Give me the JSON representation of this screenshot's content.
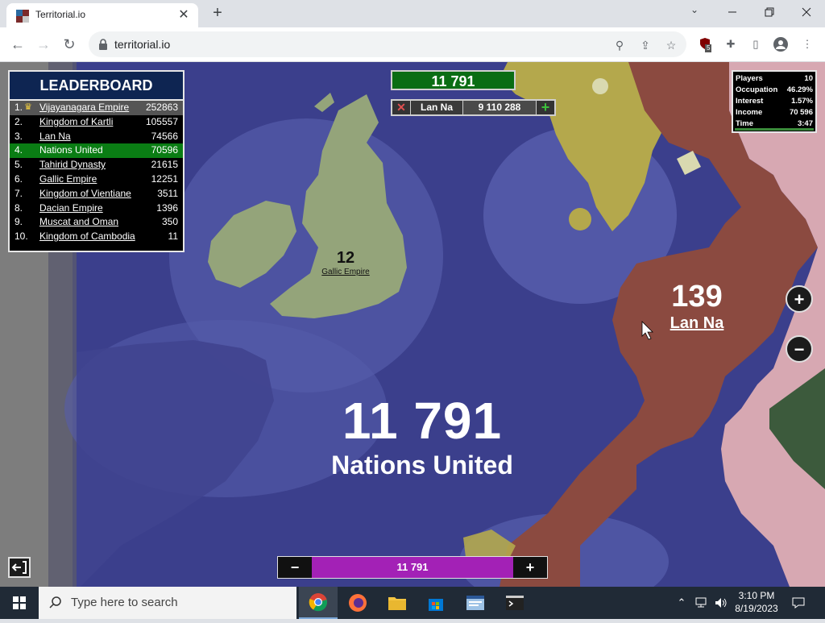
{
  "browser": {
    "tab_title": "Territorial.io",
    "url": "territorial.io",
    "extension_badge": "5"
  },
  "leaderboard": {
    "title": "LEADERBOARD",
    "rows": [
      {
        "rank": "1.",
        "name": "Vijayanagara Empire",
        "value": "252863"
      },
      {
        "rank": "2.",
        "name": "Kingdom of Kartli",
        "value": "105557"
      },
      {
        "rank": "3.",
        "name": "Lan Na",
        "value": "74566"
      },
      {
        "rank": "4.",
        "name": "Nations United",
        "value": "70596"
      },
      {
        "rank": "5.",
        "name": "Tahirid Dynasty",
        "value": "21615"
      },
      {
        "rank": "6.",
        "name": "Gallic Empire",
        "value": "12251"
      },
      {
        "rank": "7.",
        "name": "Kingdom of Vientiane",
        "value": "3511"
      },
      {
        "rank": "8.",
        "name": "Dacian Empire",
        "value": "1396"
      },
      {
        "rank": "9.",
        "name": "Muscat and Oman",
        "value": "350"
      },
      {
        "rank": "10.",
        "name": "Kingdom of Cambodia",
        "value": "11"
      }
    ]
  },
  "troops_top": "11 791",
  "attack_target": {
    "cancel_icon": "x-icon",
    "name": "Lan Na",
    "value": "9 110 288",
    "add_icon": "plus-icon"
  },
  "stats": {
    "rows": [
      {
        "label": "Players",
        "value": "10"
      },
      {
        "label": "Occupation",
        "value": "46.29%"
      },
      {
        "label": "Interest",
        "value": "1.57%"
      },
      {
        "label": "Income",
        "value": "70 596"
      },
      {
        "label": "Time",
        "value": "3:47"
      }
    ]
  },
  "map_labels": {
    "gallic": {
      "count": "12",
      "name": "Gallic Empire"
    },
    "lanna": {
      "count": "139",
      "name": "Lan Na"
    },
    "player": {
      "count": "11 791",
      "name": "Nations United"
    }
  },
  "zoom": {
    "in": "+",
    "out": "−"
  },
  "ratio_bar": {
    "minus": "−",
    "value": "11 791",
    "plus": "+",
    "fill_fraction": 1.0
  },
  "taskbar": {
    "search_placeholder": "Type here to search",
    "time": "3:10 PM",
    "date": "8/19/2023"
  },
  "colors": {
    "ocean": "#3b3f8c",
    "land_player": "#94a47a",
    "lanna": "#8b4a40",
    "pink_territory": "#d7a8b2",
    "yellow_territory": "#b4a84c",
    "leaderboard_header": "#0e2552",
    "highlight_green": "#0a7d14",
    "ratio_purple": "#a321b6"
  }
}
